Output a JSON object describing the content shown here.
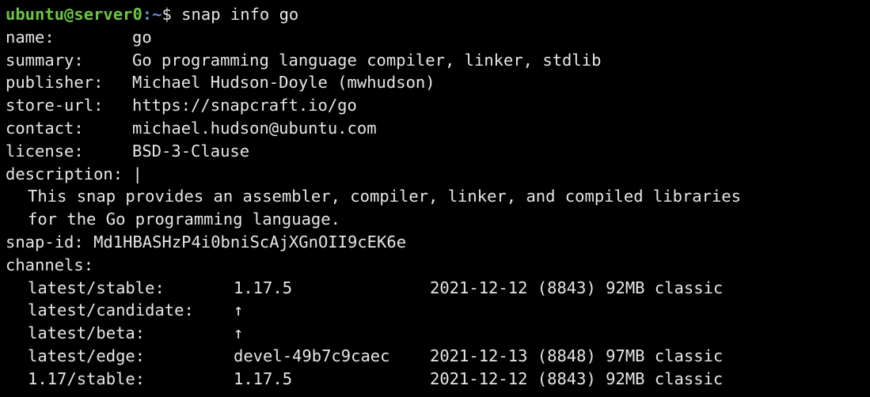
{
  "prompt": {
    "user_host": "ubuntu@server0",
    "path": ":~",
    "symbol": "$",
    "command": "snap info go"
  },
  "fields": {
    "name_key": "name:",
    "name_val": "go",
    "summary_key": "summary:",
    "summary_val": "Go programming language compiler, linker, stdlib",
    "publisher_key": "publisher:",
    "publisher_val": "Michael Hudson-Doyle (mwhudson)",
    "store_key": "store-url:",
    "store_val": "https://snapcraft.io/go",
    "contact_key": "contact:",
    "contact_val": "michael.hudson@ubuntu.com",
    "license_key": "license:",
    "license_val": "BSD-3-Clause",
    "description_key": "description:",
    "description_marker": "|",
    "description_lines": [
      "This snap provides an assembler, compiler, linker, and compiled libraries",
      "for the Go programming language."
    ],
    "snapid_key": "snap-id:",
    "snapid_val": "Md1HBASHzP4i0bniScAjXGnOII9cEK6e",
    "channels_key": "channels:"
  },
  "channels": [
    {
      "name": "latest/stable:",
      "version": "1.17.5",
      "rest": "2021-12-12 (8843) 92MB classic"
    },
    {
      "name": "latest/candidate:",
      "version": "↑",
      "rest": ""
    },
    {
      "name": "latest/beta:",
      "version": "↑",
      "rest": ""
    },
    {
      "name": "latest/edge:",
      "version": "devel-49b7c9caec",
      "rest": "2021-12-13 (8848) 97MB classic"
    },
    {
      "name": "1.17/stable:",
      "version": "1.17.5",
      "rest": "2021-12-12 (8843) 92MB classic"
    }
  ]
}
